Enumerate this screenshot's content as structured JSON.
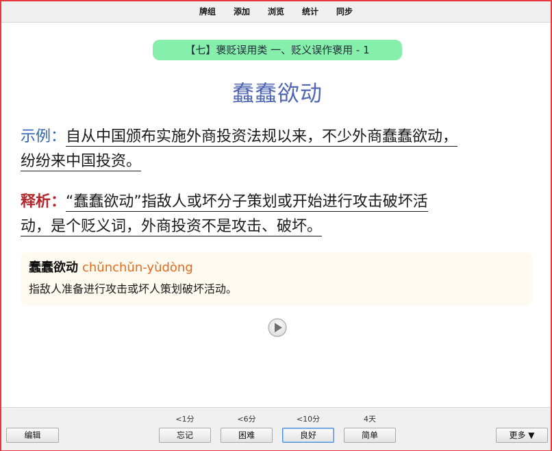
{
  "menu": {
    "items": [
      "牌组",
      "添加",
      "浏览",
      "统计",
      "同步"
    ]
  },
  "card": {
    "deck_badge": "【七】褒贬误用类 一、贬义误作褒用 - 1",
    "headword": "蠢蠢欲动",
    "example": {
      "label": "示例：",
      "line1": "自从中国颁布实施外商投资法规以来，不少外商蠢蠢欲动，",
      "line2": "纷纷来中国投资。"
    },
    "analysis": {
      "label": "释析：",
      "line1": "“蠢蠢欲动”指敌人或坏分子策划或开始进行攻击破坏活",
      "line2": "动，是个贬义词，外商投资不是攻击、破坏。"
    },
    "dictionary": {
      "word": "蠢蠢欲动",
      "pinyin": "chǔnchǔn-yùdòng",
      "definition": "指敌人准备进行攻击或坏人策划破坏活动。"
    }
  },
  "bottom": {
    "edit_label": "编辑",
    "more_label": "更多 ▼",
    "answers": [
      {
        "interval": "<1分",
        "label": "忘记"
      },
      {
        "interval": "<6分",
        "label": "困难"
      },
      {
        "interval": "<10分",
        "label": "良好"
      },
      {
        "interval": "4天",
        "label": "简单"
      }
    ]
  },
  "colors": {
    "accent_border": "#e8383d",
    "badge_bg": "#86efac",
    "headword": "#4f67b5",
    "example_label": "#2f62b5",
    "analysis_label": "#b3262b",
    "pinyin": "#e46a1e"
  }
}
